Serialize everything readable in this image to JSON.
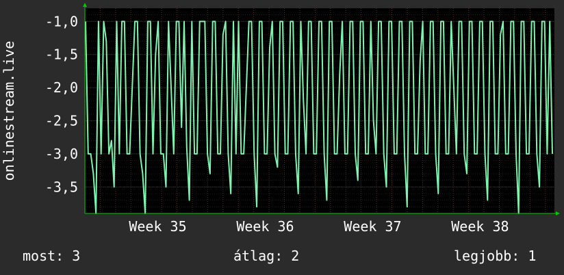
{
  "colors": {
    "background": "#2b2b2b",
    "plot_background": "#000000",
    "grid": "#3a3a3a",
    "grid_red": "#5a2a2a",
    "series": "#7ff3b0",
    "axis_arrow": "#00cc00",
    "text": "#ffffff"
  },
  "chart_data": {
    "type": "line",
    "title": "",
    "xlabel": "",
    "ylabel": "onlinestream.live",
    "ylim": [
      -3.9,
      -0.8
    ],
    "y_ticks": [
      -1.0,
      -1.5,
      -2.0,
      -2.5,
      -3.0,
      -3.5
    ],
    "y_tick_labels": [
      "-1,0",
      "-1,5",
      "-2,0",
      "-2,5",
      "-3,0",
      "-3,5"
    ],
    "x_range": [
      0,
      4.37
    ],
    "x_ticks": [
      0.5,
      1.5,
      2.5,
      3.5
    ],
    "x_tick_labels": [
      "Week 35",
      "Week 36",
      "Week 37",
      "Week 38"
    ],
    "grid": true,
    "series": [
      {
        "values": [
          -1.0,
          -3.0,
          -3.0,
          -3.3,
          -3.9,
          -1.0,
          -3.0,
          -1.0,
          -1.3,
          -3.0,
          -2.8,
          -3.5,
          -1.0,
          -3.0,
          -1.0,
          -1.0,
          -3.0,
          -3.0,
          -2.0,
          -1.0,
          -1.0,
          -3.0,
          -3.3,
          -3.9,
          -1.0,
          -1.0,
          -3.0,
          -1.5,
          -1.0,
          -3.0,
          -3.0,
          -3.5,
          -1.0,
          -2.0,
          -3.0,
          -1.0,
          -1.0,
          -2.6,
          -1.0,
          -2.9,
          -3.7,
          -1.0,
          -3.0,
          -3.0,
          -1.0,
          -1.0,
          -1.0,
          -3.0,
          -3.3,
          -1.0,
          -1.0,
          -3.0,
          -3.0,
          -1.2,
          -1.0,
          -3.0,
          -3.6,
          -1.0,
          -3.0,
          -1.0,
          -3.0,
          -3.0,
          -2.0,
          -1.0,
          -1.0,
          -3.0,
          -3.8,
          -1.0,
          -1.0,
          -3.0,
          -3.0,
          -1.4,
          -1.0,
          -3.0,
          -3.2,
          -1.0,
          -1.0,
          -3.0,
          -3.0,
          -1.0,
          -1.0,
          -3.0,
          -3.6,
          -1.0,
          -2.2,
          -3.0,
          -1.0,
          -1.0,
          -3.0,
          -3.0,
          -1.0,
          -1.0,
          -3.0,
          -3.7,
          -1.0,
          -1.0,
          -3.0,
          -3.0,
          -1.8,
          -1.0,
          -3.0,
          -3.0,
          -1.0,
          -1.0,
          -3.0,
          -3.4,
          -1.0,
          -1.0,
          -3.0,
          -3.0,
          -1.0,
          -2.5,
          -3.0,
          -1.0,
          -1.0,
          -3.0,
          -3.5,
          -1.0,
          -1.0,
          -3.0,
          -3.0,
          -1.0,
          -1.0,
          -3.0,
          -3.8,
          -1.0,
          -1.0,
          -3.0,
          -3.0,
          -1.6,
          -1.0,
          -3.0,
          -3.0,
          -1.0,
          -1.0,
          -3.0,
          -3.6,
          -1.0,
          -1.0,
          -3.0,
          -3.0,
          -1.0,
          -2.0,
          -3.0,
          -1.0,
          -1.0,
          -3.0,
          -3.3,
          -1.0,
          -1.0,
          -3.0,
          -3.0,
          -1.0,
          -1.0,
          -3.0,
          -3.7,
          -1.0,
          -1.0,
          -3.0,
          -3.0,
          -1.2,
          -1.0,
          -3.0,
          -3.0,
          -1.0,
          -1.0,
          -3.0,
          -3.9,
          -1.0,
          -1.0,
          -3.0,
          -3.0,
          -1.0,
          -1.0,
          -3.0,
          -3.5,
          -1.0,
          -1.0,
          -3.0,
          -1.0,
          -3.0
        ]
      }
    ]
  },
  "stats": {
    "now_label": "most:",
    "now_value": "3",
    "avg_label": "átlag:",
    "avg_value": "2",
    "max_label": "legjobb:",
    "max_value": "1"
  }
}
